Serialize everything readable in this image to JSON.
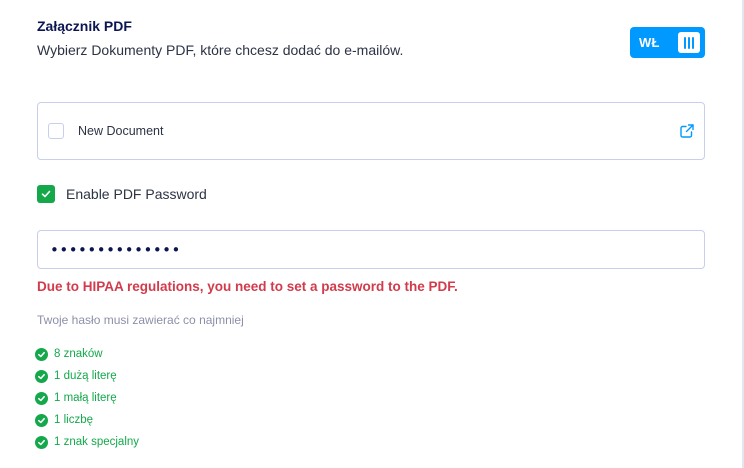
{
  "header": {
    "title": "Załącznik PDF",
    "subtitle": "Wybierz Dokumenty PDF, które chcesz dodać do e-mailów."
  },
  "toggle": {
    "label": "WŁ",
    "state": "on"
  },
  "documents": [
    {
      "label": "New Document",
      "checked": false
    }
  ],
  "pdf_password": {
    "label": "Enable PDF Password",
    "checked": true,
    "value": "••••••••••••••",
    "error": "Due to HIPAA regulations, you need to set a password to the PDF."
  },
  "requirements": {
    "intro": "Twoje hasło musi zawierać co najmniej",
    "items": [
      {
        "label": "8 znaków",
        "met": true
      },
      {
        "label": "1 dużą literę",
        "met": true
      },
      {
        "label": "1 małą literę",
        "met": true
      },
      {
        "label": "1 liczbę",
        "met": true
      },
      {
        "label": "1 znak specjalny",
        "met": true
      }
    ]
  },
  "colors": {
    "accent": "#0099ff",
    "success": "#14a84b",
    "error": "#d13b4c",
    "text": "#0a1551",
    "border": "#c8ceed"
  },
  "icons": {
    "external_link": "external-link-icon",
    "check": "check-icon"
  }
}
